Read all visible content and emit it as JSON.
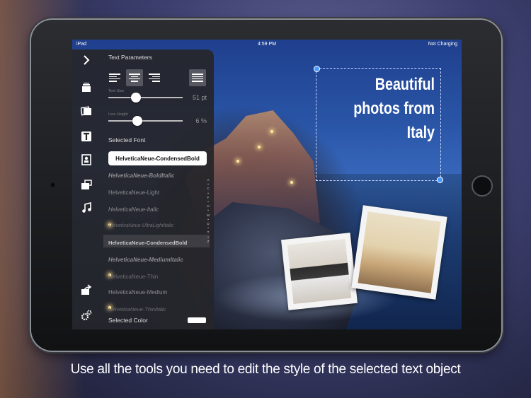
{
  "status_bar": {
    "carrier": "iPad",
    "time": "4:59 PM",
    "battery": "Not Charging"
  },
  "side_icons": [
    "chevron-right-icon",
    "layers-icon",
    "photos-icon",
    "text-icon",
    "frame-icon",
    "stickers-icon",
    "music-icon",
    "share-icon",
    "settings-icon"
  ],
  "panel": {
    "title": "Text Parameters",
    "text_size_label": "Text Size",
    "text_size_value": "51 pt",
    "line_height_label": "Line Height",
    "line_height_value": "6 %",
    "selected_font_label": "Selected Font",
    "selected_font": "HelveticaNeue-CondensedBold",
    "fonts": [
      "HelveticaNeue-BoldItalic",
      "HelveticaNeue-Light",
      "HelveticaNeue-Italic",
      "HelveticaNeue-UltraLightItalic",
      "HelveticaNeue-CondensedBold",
      "HelveticaNeue-MediumItalic",
      "HelveticaNeue-Thin",
      "HelveticaNeue-Medium",
      "HelveticaNeue-ThinItalic"
    ],
    "alphabet": [
      "A",
      "C",
      "F",
      "H",
      "M",
      "O",
      "T",
      "Z"
    ],
    "selected_color_label": "Selected Color",
    "selected_color": "#ffffff"
  },
  "canvas": {
    "headline_lines": [
      "Beautiful",
      "photos from",
      "Italy"
    ]
  },
  "caption": "Use all the tools you need to edit the style of the selected text object"
}
